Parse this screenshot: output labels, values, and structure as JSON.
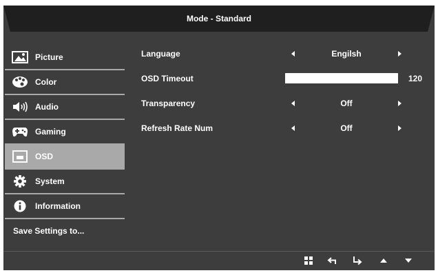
{
  "title": "Mode - Standard",
  "menu": [
    {
      "label": "Picture",
      "icon": "picture-icon"
    },
    {
      "label": "Color",
      "icon": "palette-icon"
    },
    {
      "label": "Audio",
      "icon": "speaker-icon"
    },
    {
      "label": "Gaming",
      "icon": "gamepad-icon"
    },
    {
      "label": "OSD",
      "icon": "osd-icon",
      "selected": true
    },
    {
      "label": "System",
      "icon": "gear-icon"
    },
    {
      "label": "Information",
      "icon": "info-icon"
    },
    {
      "label": "Save Settings to..."
    }
  ],
  "settings": {
    "language": {
      "label": "Language",
      "value": "Engilsh"
    },
    "osd_timeout": {
      "label": "OSD Timeout",
      "value": "120",
      "fill_fraction": 1.0
    },
    "transparency": {
      "label": "Transparency",
      "value": "Off"
    },
    "refresh_rate_num": {
      "label": "Refresh Rate Num",
      "value": "Off"
    }
  },
  "nav_icons": [
    "menu-grid-icon",
    "back-icon",
    "enter-icon",
    "up-arrow-icon",
    "down-arrow-icon"
  ],
  "colors": {
    "panel": "#3d3d3d",
    "title_bar": "#1f1f1f",
    "highlight": "#a9a9a9",
    "text": "#ffffff"
  }
}
